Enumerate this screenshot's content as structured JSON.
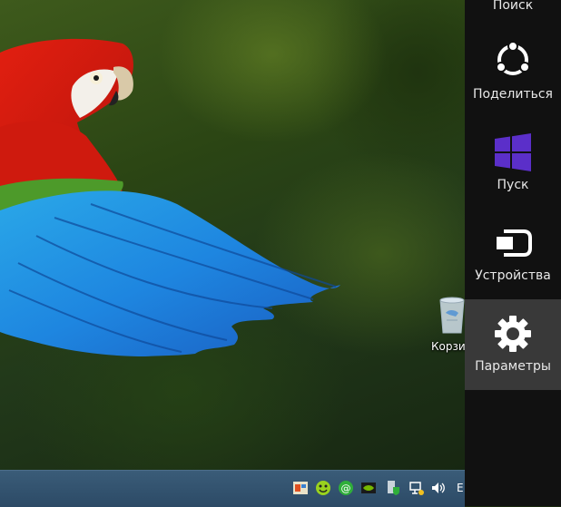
{
  "desktop": {
    "recycle_bin_label": "Корзи"
  },
  "charms": {
    "accent_color": "#5b2fc9",
    "items": [
      {
        "label": "Поиск",
        "icon": "search-icon",
        "active": false
      },
      {
        "label": "Поделиться",
        "icon": "share-icon",
        "active": false
      },
      {
        "label": "Пуск",
        "icon": "windows-logo-icon",
        "active": false
      },
      {
        "label": "Устройства",
        "icon": "devices-icon",
        "active": false
      },
      {
        "label": "Параметры",
        "icon": "gear-icon",
        "active": true
      }
    ]
  },
  "taskbar": {
    "language": "E",
    "tray_icons": [
      "app-icon",
      "smiley-app-icon",
      "at-sign-icon",
      "nvidia-icon",
      "security-shield-icon",
      "network-icon",
      "volume-icon"
    ]
  }
}
